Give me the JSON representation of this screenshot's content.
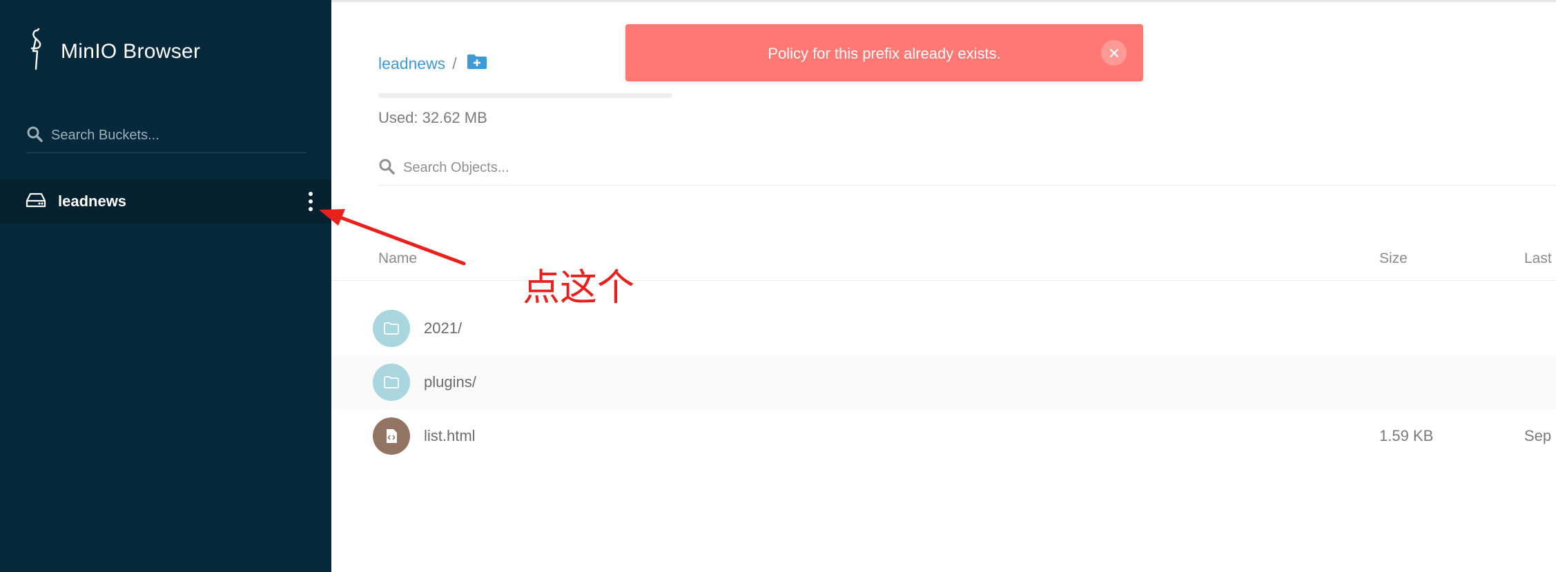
{
  "sidebar": {
    "brand": "MinIO Browser",
    "search_placeholder": "Search Buckets...",
    "buckets": [
      {
        "name": "leadnews"
      }
    ]
  },
  "main": {
    "breadcrumb": {
      "bucket": "leadnews",
      "separator": "/"
    },
    "usage": {
      "text": "Used: 32.62 MB",
      "fill_fraction": 0.0
    },
    "search_placeholder": "Search Objects...",
    "columns": {
      "name": "Name",
      "size": "Size",
      "last_modified": "Last"
    },
    "objects": [
      {
        "name": "2021/",
        "size": "",
        "date": "",
        "kind": "folder"
      },
      {
        "name": "plugins/",
        "size": "",
        "date": "",
        "kind": "folder"
      },
      {
        "name": "list.html",
        "size": "1.59 KB",
        "date": "Sep",
        "kind": "file"
      }
    ]
  },
  "toast": {
    "message": "Policy for this prefix already exists.",
    "color": "#ff7873"
  },
  "annotation": {
    "text": "点这个",
    "color": "#e8211f"
  },
  "icons": {
    "logo": "minio-bird-icon",
    "bucket_search": "search-icon",
    "bucket": "drive-icon",
    "bucket_menu": "more-vertical-icon",
    "new_folder": "folder-plus-icon",
    "object_search": "search-icon",
    "folder": "folder-icon",
    "file": "file-code-icon",
    "toast_close": "close-icon"
  },
  "colors": {
    "sidebar_bg": "#06283b",
    "link": "#3f9ad8",
    "folder_icon_bg": "#a9d6df",
    "file_icon_bg": "#937463"
  }
}
